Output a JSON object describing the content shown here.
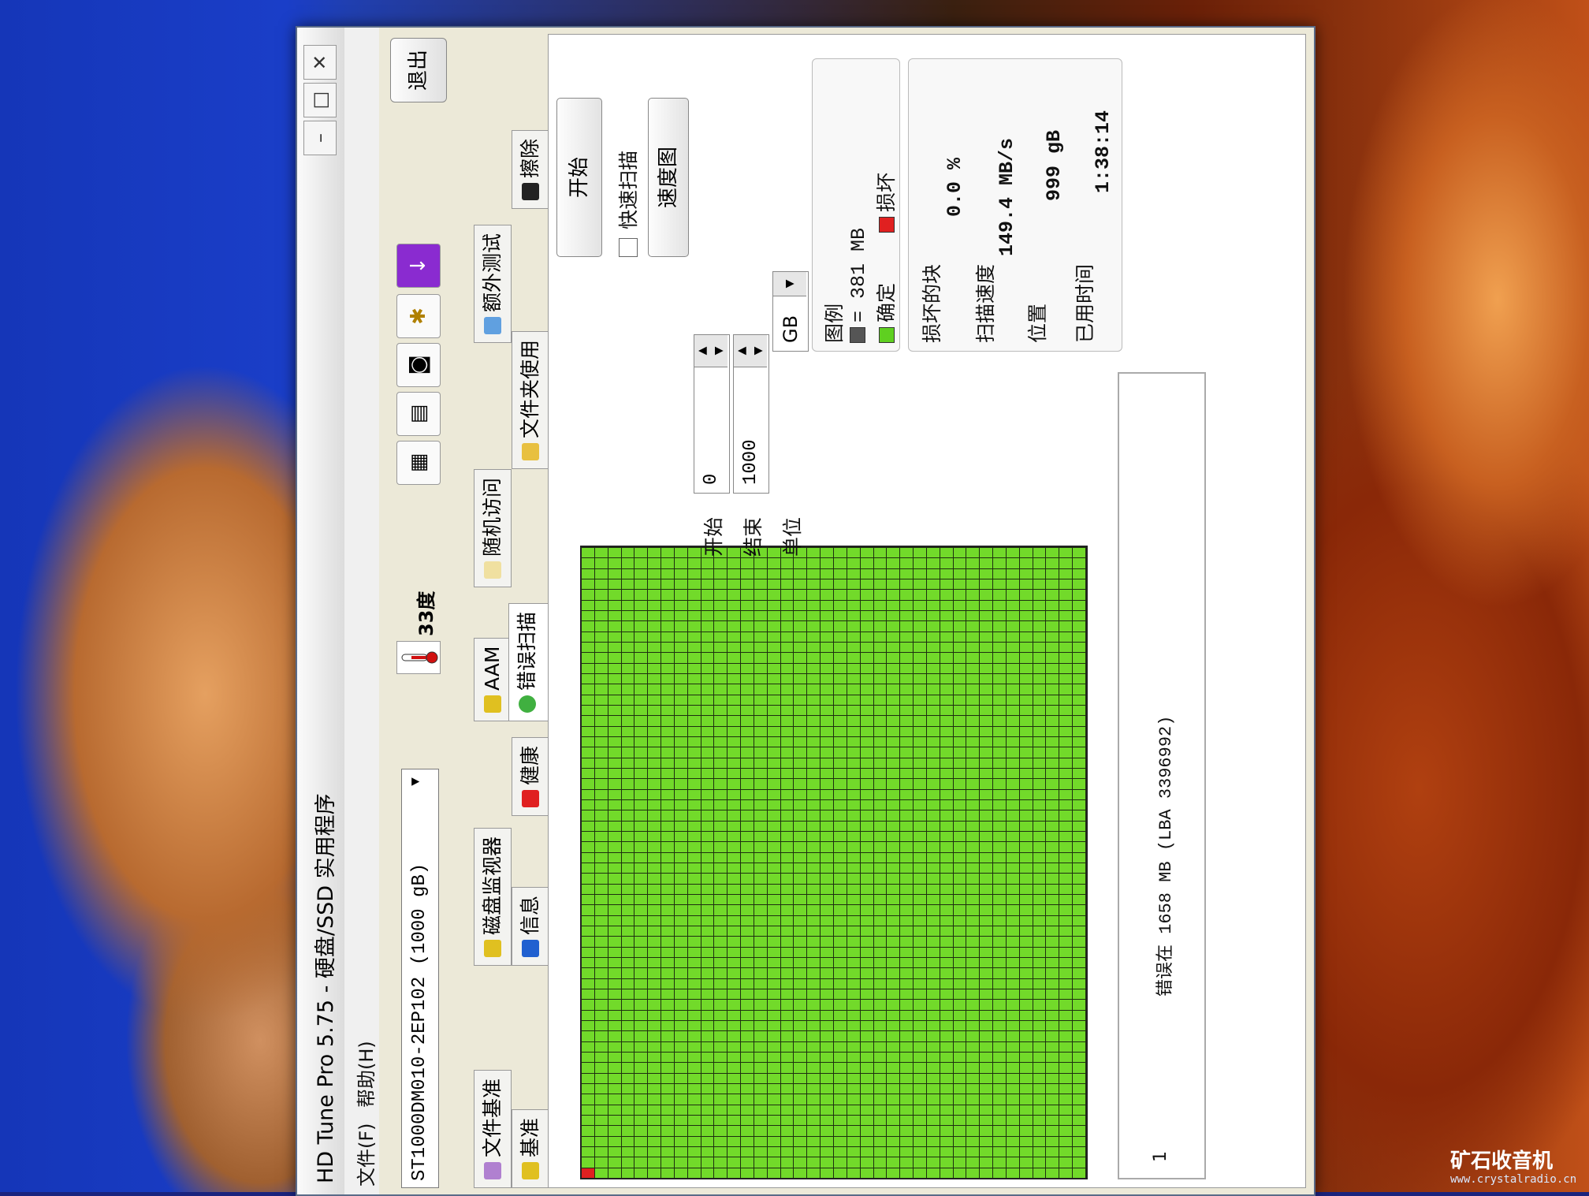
{
  "window": {
    "title": "HD Tune Pro 5.75 - 硬盘/SSD 实用程序",
    "minimize": "–",
    "maximize": "□",
    "close": "✕"
  },
  "menu": {
    "file": "文件(F)",
    "help": "帮助(H)"
  },
  "toolbar": {
    "drive": "ST1000DM010-2EP102 (1000 gB)",
    "temperature": "33度",
    "exit_label": "退出"
  },
  "tabs": {
    "row1": [
      "基准",
      "信息",
      "健康",
      "错误扫描",
      "文件夹使用",
      "擦除"
    ],
    "row2": [
      "文件基准",
      "磁盘监视器",
      "AAM",
      "随机访问",
      "额外测试"
    ],
    "active": "错误扫描"
  },
  "controls": {
    "start_button": "开始",
    "quick_scan_label": "快速扫描",
    "map_button": "速度图",
    "start_label": "开始",
    "start_value": "0",
    "end_label": "结束",
    "end_value": "1000",
    "unit_label": "单位",
    "unit_value": "GB"
  },
  "legend": {
    "title": "图例",
    "block_size": "= 381 MB",
    "ok_label": "确定",
    "bad_label": "损坏",
    "colors": {
      "block": "#555555",
      "ok": "#5fd020",
      "bad": "#e02020"
    }
  },
  "stats": {
    "damaged_label": "损坏的块",
    "damaged_value": "0.0 %",
    "speed_label": "扫描速度",
    "speed_value": "149.4 MB/s",
    "position_label": "位置",
    "position_value": "999 gB",
    "elapsed_label": "已用时间",
    "elapsed_value": "1:38:14"
  },
  "status": {
    "index": "1",
    "message": "错误在 1658 MB (LBA 3396992)"
  },
  "block_map": {
    "rows": 38,
    "cols": 60,
    "bad_blocks": [
      [
        0,
        0
      ]
    ]
  },
  "watermark": {
    "name": "矿石收音机",
    "url": "www.crystalradio.cn"
  }
}
